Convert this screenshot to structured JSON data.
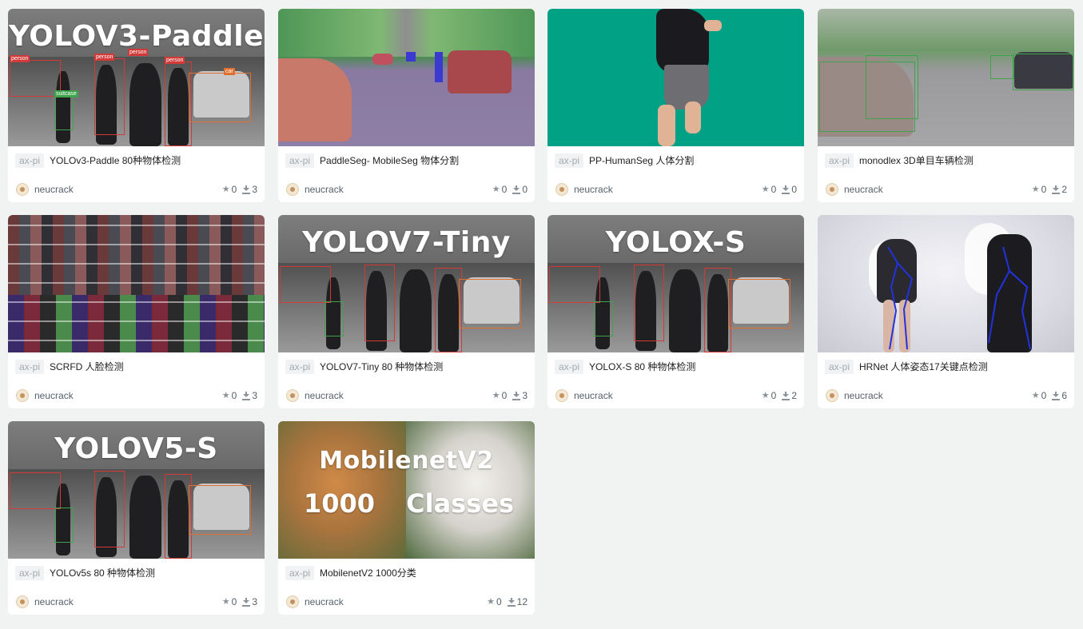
{
  "cards": [
    {
      "tag": "ax-pi",
      "name": "YOLOv3-Paddle 80种物体检测",
      "author": "neucrack",
      "stars": "0",
      "downloads": "3",
      "thumb_title": "YOLOV3-Paddle"
    },
    {
      "tag": "ax-pi",
      "name": "PaddleSeg- MobileSeg 物体分割",
      "author": "neucrack",
      "stars": "0",
      "downloads": "0",
      "thumb_title": ""
    },
    {
      "tag": "ax-pi",
      "name": "PP-HumanSeg 人体分割",
      "author": "neucrack",
      "stars": "0",
      "downloads": "0",
      "thumb_title": ""
    },
    {
      "tag": "ax-pi",
      "name": "monodlex 3D单目车辆检测",
      "author": "neucrack",
      "stars": "0",
      "downloads": "2",
      "thumb_title": ""
    },
    {
      "tag": "ax-pi",
      "name": "SCRFD 人脸检测",
      "author": "neucrack",
      "stars": "0",
      "downloads": "3",
      "thumb_title": ""
    },
    {
      "tag": "ax-pi",
      "name": "YOLOV7-Tiny 80 种物体检测",
      "author": "neucrack",
      "stars": "0",
      "downloads": "3",
      "thumb_title": "YOLOV7-Tiny"
    },
    {
      "tag": "ax-pi",
      "name": "YOLOX-S 80 种物体检测",
      "author": "neucrack",
      "stars": "0",
      "downloads": "2",
      "thumb_title": "YOLOX-S"
    },
    {
      "tag": "ax-pi",
      "name": "HRNet 人体姿态17关键点检测",
      "author": "neucrack",
      "stars": "0",
      "downloads": "6",
      "thumb_title": ""
    },
    {
      "tag": "ax-pi",
      "name": "YOLOv5s 80 种物体检测",
      "author": "neucrack",
      "stars": "0",
      "downloads": "3",
      "thumb_title": "YOLOV5-S"
    },
    {
      "tag": "ax-pi",
      "name": "MobilenetV2 1000分类",
      "author": "neucrack",
      "stars": "0",
      "downloads": "12",
      "thumb_title": "MobilenetV2",
      "thumb_subtitle_a": "1000",
      "thumb_subtitle_b": "Classes"
    }
  ],
  "icons": {
    "star": "star-icon",
    "download": "download-icon",
    "avatar": "avatar"
  },
  "colors": {
    "page_bg": "#f1f3f3",
    "card_bg": "#ffffff",
    "tag_bg": "#f1f2f3",
    "tag_text": "#a3a9ae",
    "seg_green": "#00a184",
    "seg_purple": "#7c6a98"
  }
}
